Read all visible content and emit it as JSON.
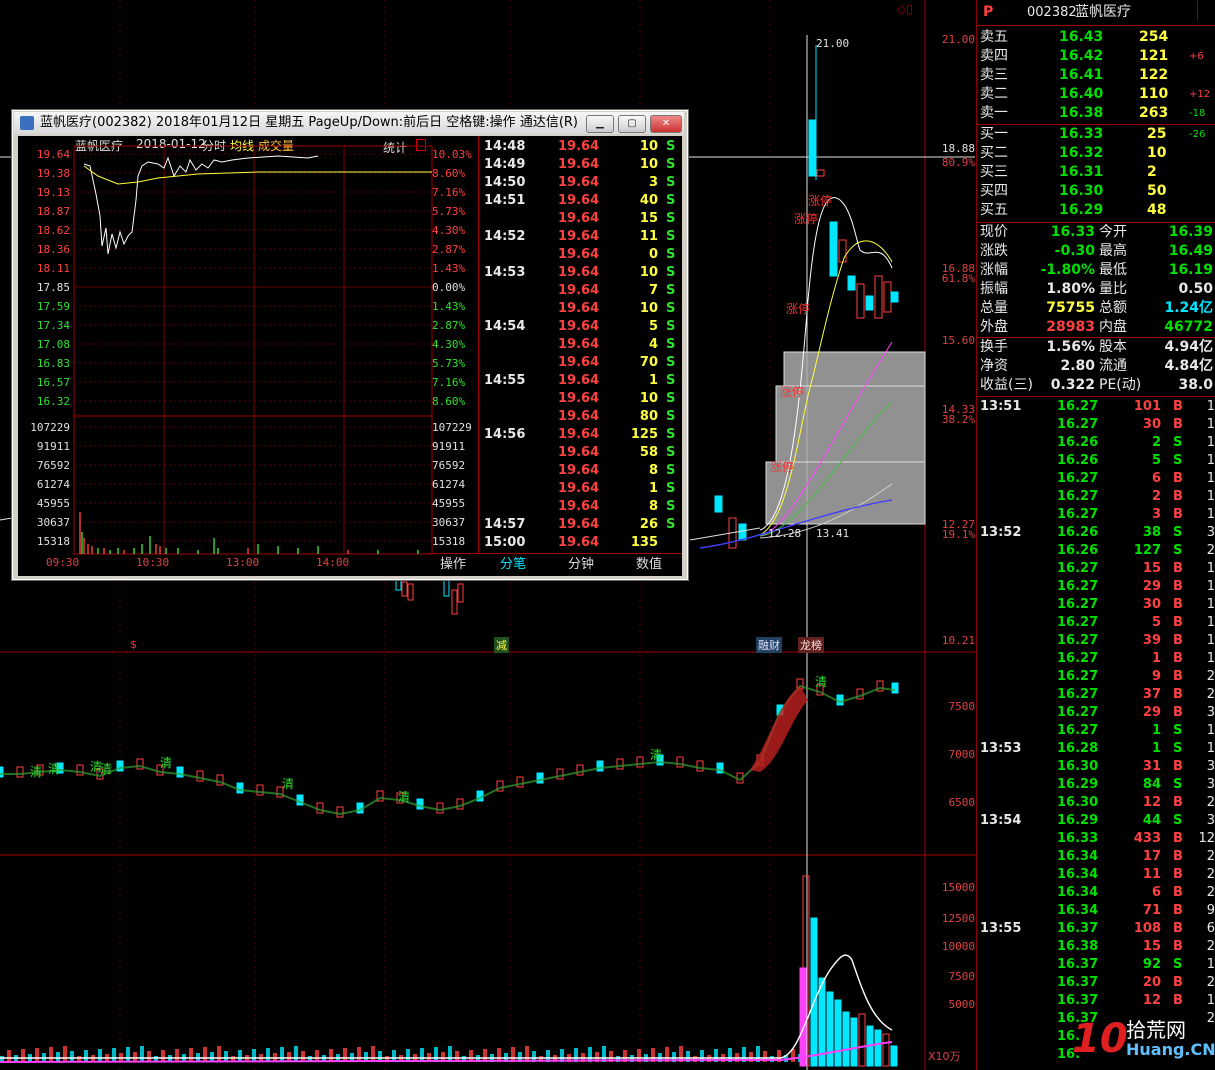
{
  "main_chart": {
    "price_axis": [
      "21.00",
      "18.88",
      "16.88",
      "15.60",
      "14.33",
      "12.27",
      "10.21"
    ],
    "pct_axis": [
      "80.9%",
      "61.8%",
      "38.2%",
      "19.1%"
    ],
    "price_annotations": {
      "high": "21.00",
      "low": "12.28",
      "mid": "13.41"
    },
    "limit_up_labels": [
      "涨停",
      "涨停",
      "涨停",
      "涨停",
      "涨停"
    ],
    "event_markers": [
      "$",
      "减",
      "融财",
      "龙榜"
    ],
    "mid_axis": [
      "7500",
      "7000",
      "6500"
    ],
    "mid_labels": [
      "清",
      "清",
      "清",
      "清",
      "清",
      "清",
      "清",
      "清",
      "清"
    ],
    "vol_axis": [
      "15000",
      "12500",
      "10000",
      "7500",
      "5000"
    ],
    "vol_unit": "X10万"
  },
  "quote": {
    "letter": "P",
    "code": "002382",
    "name": "蓝帆医疗",
    "asks": [
      {
        "label": "卖五",
        "price": "16.43",
        "vol": "254",
        "chg": ""
      },
      {
        "label": "卖四",
        "price": "16.42",
        "vol": "121",
        "chg": "+6"
      },
      {
        "label": "卖三",
        "price": "16.41",
        "vol": "122",
        "chg": ""
      },
      {
        "label": "卖二",
        "price": "16.40",
        "vol": "110",
        "chg": "+12"
      },
      {
        "label": "卖一",
        "price": "16.38",
        "vol": "263",
        "chg": "-18"
      }
    ],
    "bids": [
      {
        "label": "买一",
        "price": "16.33",
        "vol": "25",
        "chg": "-26"
      },
      {
        "label": "买二",
        "price": "16.32",
        "vol": "10",
        "chg": ""
      },
      {
        "label": "买三",
        "price": "16.31",
        "vol": "2",
        "chg": ""
      },
      {
        "label": "买四",
        "price": "16.30",
        "vol": "50",
        "chg": ""
      },
      {
        "label": "买五",
        "price": "16.29",
        "vol": "48",
        "chg": ""
      }
    ],
    "stats": [
      {
        "l1": "现价",
        "v1": "16.33",
        "c1": "green",
        "l2": "今开",
        "v2": "16.39",
        "c2": "green"
      },
      {
        "l1": "涨跌",
        "v1": "-0.30",
        "c1": "green",
        "l2": "最高",
        "v2": "16.49",
        "c2": "green"
      },
      {
        "l1": "涨幅",
        "v1": "-1.80%",
        "c1": "green",
        "l2": "最低",
        "v2": "16.19",
        "c2": "green"
      },
      {
        "l1": "振幅",
        "v1": "1.80%",
        "c1": "white",
        "l2": "量比",
        "v2": "0.50",
        "c2": "white"
      },
      {
        "l1": "总量",
        "v1": "75755",
        "c1": "yellow",
        "l2": "总额",
        "v2": "1.24亿",
        "c2": "cyan"
      },
      {
        "l1": "外盘",
        "v1": "28983",
        "c1": "red",
        "l2": "内盘",
        "v2": "46772",
        "c2": "green"
      }
    ],
    "stats2": [
      {
        "l1": "换手",
        "v1": "1.56%",
        "l2": "股本",
        "v2": "4.94亿"
      },
      {
        "l1": "净资",
        "v1": "2.80",
        "l2": "流通",
        "v2": "4.84亿"
      },
      {
        "l1": "收益(三)",
        "v1": "0.322",
        "l2": "PE(动)",
        "v2": "38.0"
      }
    ],
    "trades": [
      {
        "t": "13:51",
        "p": "16.27",
        "v": "101",
        "s": "B",
        "n": "1"
      },
      {
        "t": "",
        "p": "16.27",
        "v": "30",
        "s": "B",
        "n": "1"
      },
      {
        "t": "",
        "p": "16.26",
        "v": "2",
        "s": "S",
        "n": "1"
      },
      {
        "t": "",
        "p": "16.26",
        "v": "5",
        "s": "S",
        "n": "1"
      },
      {
        "t": "",
        "p": "16.27",
        "v": "6",
        "s": "B",
        "n": "1"
      },
      {
        "t": "",
        "p": "16.27",
        "v": "2",
        "s": "B",
        "n": "1"
      },
      {
        "t": "",
        "p": "16.27",
        "v": "3",
        "s": "B",
        "n": "1"
      },
      {
        "t": "13:52",
        "p": "16.26",
        "v": "38",
        "s": "S",
        "n": "3"
      },
      {
        "t": "",
        "p": "16.26",
        "v": "127",
        "s": "S",
        "n": "2"
      },
      {
        "t": "",
        "p": "16.27",
        "v": "15",
        "s": "B",
        "n": "1"
      },
      {
        "t": "",
        "p": "16.27",
        "v": "29",
        "s": "B",
        "n": "1"
      },
      {
        "t": "",
        "p": "16.27",
        "v": "30",
        "s": "B",
        "n": "1"
      },
      {
        "t": "",
        "p": "16.27",
        "v": "5",
        "s": "B",
        "n": "1"
      },
      {
        "t": "",
        "p": "16.27",
        "v": "39",
        "s": "B",
        "n": "1"
      },
      {
        "t": "",
        "p": "16.27",
        "v": "1",
        "s": "B",
        "n": "1"
      },
      {
        "t": "",
        "p": "16.27",
        "v": "9",
        "s": "B",
        "n": "2"
      },
      {
        "t": "",
        "p": "16.27",
        "v": "37",
        "s": "B",
        "n": "2"
      },
      {
        "t": "",
        "p": "16.27",
        "v": "29",
        "s": "B",
        "n": "3"
      },
      {
        "t": "",
        "p": "16.27",
        "v": "1",
        "s": "S",
        "n": "1"
      },
      {
        "t": "13:53",
        "p": "16.28",
        "v": "1",
        "s": "S",
        "n": "1"
      },
      {
        "t": "",
        "p": "16.30",
        "v": "31",
        "s": "B",
        "n": "3"
      },
      {
        "t": "",
        "p": "16.29",
        "v": "84",
        "s": "S",
        "n": "3"
      },
      {
        "t": "",
        "p": "16.30",
        "v": "12",
        "s": "B",
        "n": "2"
      },
      {
        "t": "13:54",
        "p": "16.29",
        "v": "44",
        "s": "S",
        "n": "3"
      },
      {
        "t": "",
        "p": "16.33",
        "v": "433",
        "s": "B",
        "n": "12"
      },
      {
        "t": "",
        "p": "16.34",
        "v": "17",
        "s": "B",
        "n": "2"
      },
      {
        "t": "",
        "p": "16.34",
        "v": "11",
        "s": "B",
        "n": "2"
      },
      {
        "t": "",
        "p": "16.34",
        "v": "6",
        "s": "B",
        "n": "2"
      },
      {
        "t": "",
        "p": "16.34",
        "v": "71",
        "s": "B",
        "n": "9"
      },
      {
        "t": "13:55",
        "p": "16.37",
        "v": "108",
        "s": "B",
        "n": "6"
      },
      {
        "t": "",
        "p": "16.38",
        "v": "15",
        "s": "B",
        "n": "2"
      },
      {
        "t": "",
        "p": "16.37",
        "v": "92",
        "s": "S",
        "n": "1"
      },
      {
        "t": "",
        "p": "16.37",
        "v": "20",
        "s": "B",
        "n": "2"
      },
      {
        "t": "",
        "p": "16.37",
        "v": "12",
        "s": "B",
        "n": "1"
      },
      {
        "t": "",
        "p": "16.37",
        "v": "",
        "s": "",
        "n": "2"
      },
      {
        "t": "",
        "p": "16.",
        "v": "",
        "s": "",
        "n": ""
      },
      {
        "t": "",
        "p": "16.",
        "v": "",
        "s": "",
        "n": ""
      }
    ]
  },
  "popup": {
    "title": "蓝帆医疗(002382) 2018年01月12日 星期五 PageUp/Down:前后日 空格键:操作 通达信(R)",
    "header": {
      "name": "蓝帆医疗",
      "date": "2018-01-12",
      "mode": "分时",
      "avg": "均线",
      "vol": "成交量",
      "stat": "统计"
    },
    "y_left": [
      "19.64",
      "19.38",
      "19.13",
      "18.87",
      "18.62",
      "18.36",
      "18.11",
      "17.85",
      "17.59",
      "17.34",
      "17.08",
      "16.83",
      "16.57",
      "16.32",
      "107229",
      "91911",
      "76592",
      "61274",
      "45955",
      "30637",
      "15318"
    ],
    "y_right": [
      "10.03%",
      "8.60%",
      "7.16%",
      "5.73%",
      "4.30%",
      "2.87%",
      "1.43%",
      "0.00%",
      "1.43%",
      "2.87%",
      "4.30%",
      "5.73%",
      "7.16%",
      "8.60%",
      "107229",
      "91911",
      "76592",
      "61274",
      "45955",
      "30637",
      "15318"
    ],
    "x_labels": [
      "09:30",
      "10:30",
      "13:00",
      "14:00"
    ],
    "ticks": [
      {
        "t": "14:48",
        "p": "19.64",
        "v": "10",
        "s": "S"
      },
      {
        "t": "14:49",
        "p": "19.64",
        "v": "10",
        "s": "S"
      },
      {
        "t": "14:50",
        "p": "19.64",
        "v": "3",
        "s": "S"
      },
      {
        "t": "14:51",
        "p": "19.64",
        "v": "40",
        "s": "S"
      },
      {
        "t": "",
        "p": "19.64",
        "v": "15",
        "s": "S"
      },
      {
        "t": "14:52",
        "p": "19.64",
        "v": "11",
        "s": "S"
      },
      {
        "t": "",
        "p": "19.64",
        "v": "0",
        "s": "S"
      },
      {
        "t": "14:53",
        "p": "19.64",
        "v": "10",
        "s": "S"
      },
      {
        "t": "",
        "p": "19.64",
        "v": "7",
        "s": "S"
      },
      {
        "t": "",
        "p": "19.64",
        "v": "10",
        "s": "S"
      },
      {
        "t": "14:54",
        "p": "19.64",
        "v": "5",
        "s": "S"
      },
      {
        "t": "",
        "p": "19.64",
        "v": "4",
        "s": "S"
      },
      {
        "t": "",
        "p": "19.64",
        "v": "70",
        "s": "S"
      },
      {
        "t": "14:55",
        "p": "19.64",
        "v": "1",
        "s": "S"
      },
      {
        "t": "",
        "p": "19.64",
        "v": "10",
        "s": "S"
      },
      {
        "t": "",
        "p": "19.64",
        "v": "80",
        "s": "S"
      },
      {
        "t": "14:56",
        "p": "19.64",
        "v": "125",
        "s": "S"
      },
      {
        "t": "",
        "p": "19.64",
        "v": "58",
        "s": "S"
      },
      {
        "t": "",
        "p": "19.64",
        "v": "8",
        "s": "S"
      },
      {
        "t": "",
        "p": "19.64",
        "v": "1",
        "s": "S"
      },
      {
        "t": "",
        "p": "19.64",
        "v": "8",
        "s": "S"
      },
      {
        "t": "14:57",
        "p": "19.64",
        "v": "26",
        "s": "S"
      },
      {
        "t": "15:00",
        "p": "19.64",
        "v": "135",
        "s": ""
      }
    ],
    "tabs": [
      "操作",
      "分笔",
      "分钟",
      "数值"
    ]
  },
  "watermark": {
    "num": "10",
    "text": "拾荒网",
    "site": "Huang.CN"
  }
}
